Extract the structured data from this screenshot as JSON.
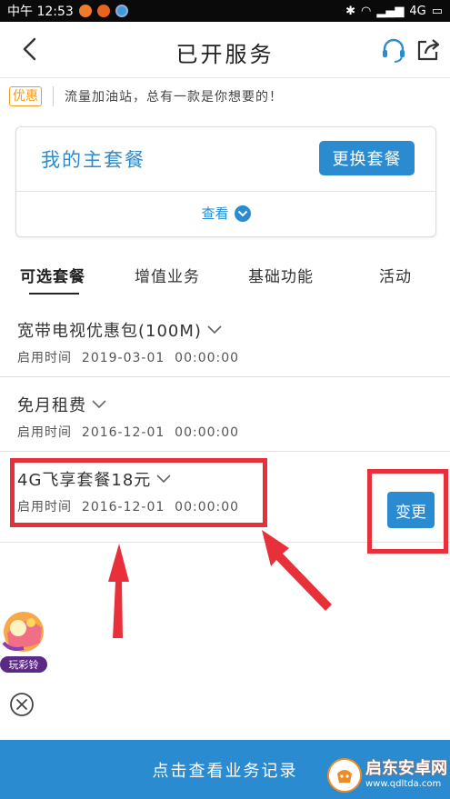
{
  "status_bar": {
    "time_label": "中午 12:53",
    "network": "4G"
  },
  "nav": {
    "title": "已开服务"
  },
  "notice": {
    "badge": "优惠",
    "text": "流量加油站，总有一款是你想要的！"
  },
  "main_package": {
    "title": "我的主套餐",
    "change_button": "更换套餐",
    "view_label": "查看"
  },
  "tabs": [
    {
      "label": "可选套餐"
    },
    {
      "label": "增值业务"
    },
    {
      "label": "基础功能"
    },
    {
      "label": "活动"
    }
  ],
  "packages": [
    {
      "name": "宽带电视优惠包(100M)",
      "time_label": "启用时间",
      "time": "2019-03-01  00:00:00"
    },
    {
      "name": "免月租费",
      "time_label": "启用时间",
      "time": "2016-12-01  00:00:00"
    },
    {
      "name": "4G飞享套餐18元",
      "time_label": "启用时间",
      "time": "2016-12-01  00:00:00"
    }
  ],
  "change_button": "变更",
  "promo": {
    "label": "玩彩铃"
  },
  "bottom_bar": {
    "label": "点击查看业务记录"
  },
  "watermark": {
    "main": "启东安卓网",
    "sub": "www.qdltda.com"
  },
  "colors": {
    "accent": "#2a8bd0",
    "annotation": "#e8303a",
    "badge": "#f39b1e"
  }
}
